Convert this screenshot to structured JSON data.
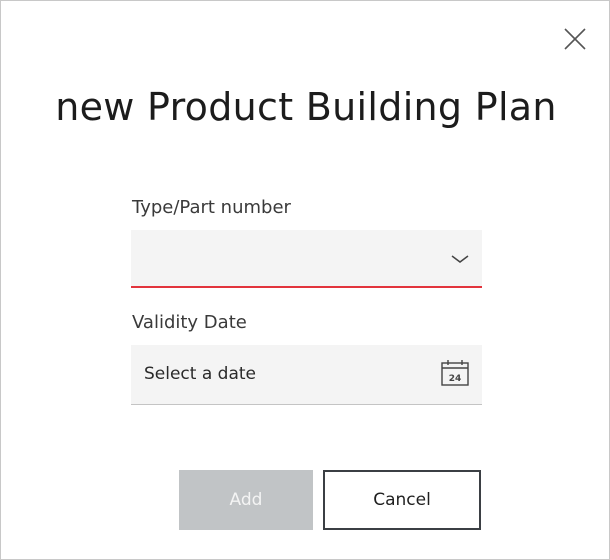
{
  "dialog": {
    "title": "new Product Building Plan",
    "close_icon": "close-icon"
  },
  "form": {
    "type_part_number": {
      "label": "Type/Part number",
      "value": "",
      "icon": "chevron-down-icon",
      "error_color": "#e2343c"
    },
    "validity_date": {
      "label": "Validity Date",
      "placeholder": "Select a date",
      "icon": "calendar-icon",
      "calendar_day": "24"
    }
  },
  "actions": {
    "add_label": "Add",
    "add_disabled": true,
    "cancel_label": "Cancel"
  }
}
